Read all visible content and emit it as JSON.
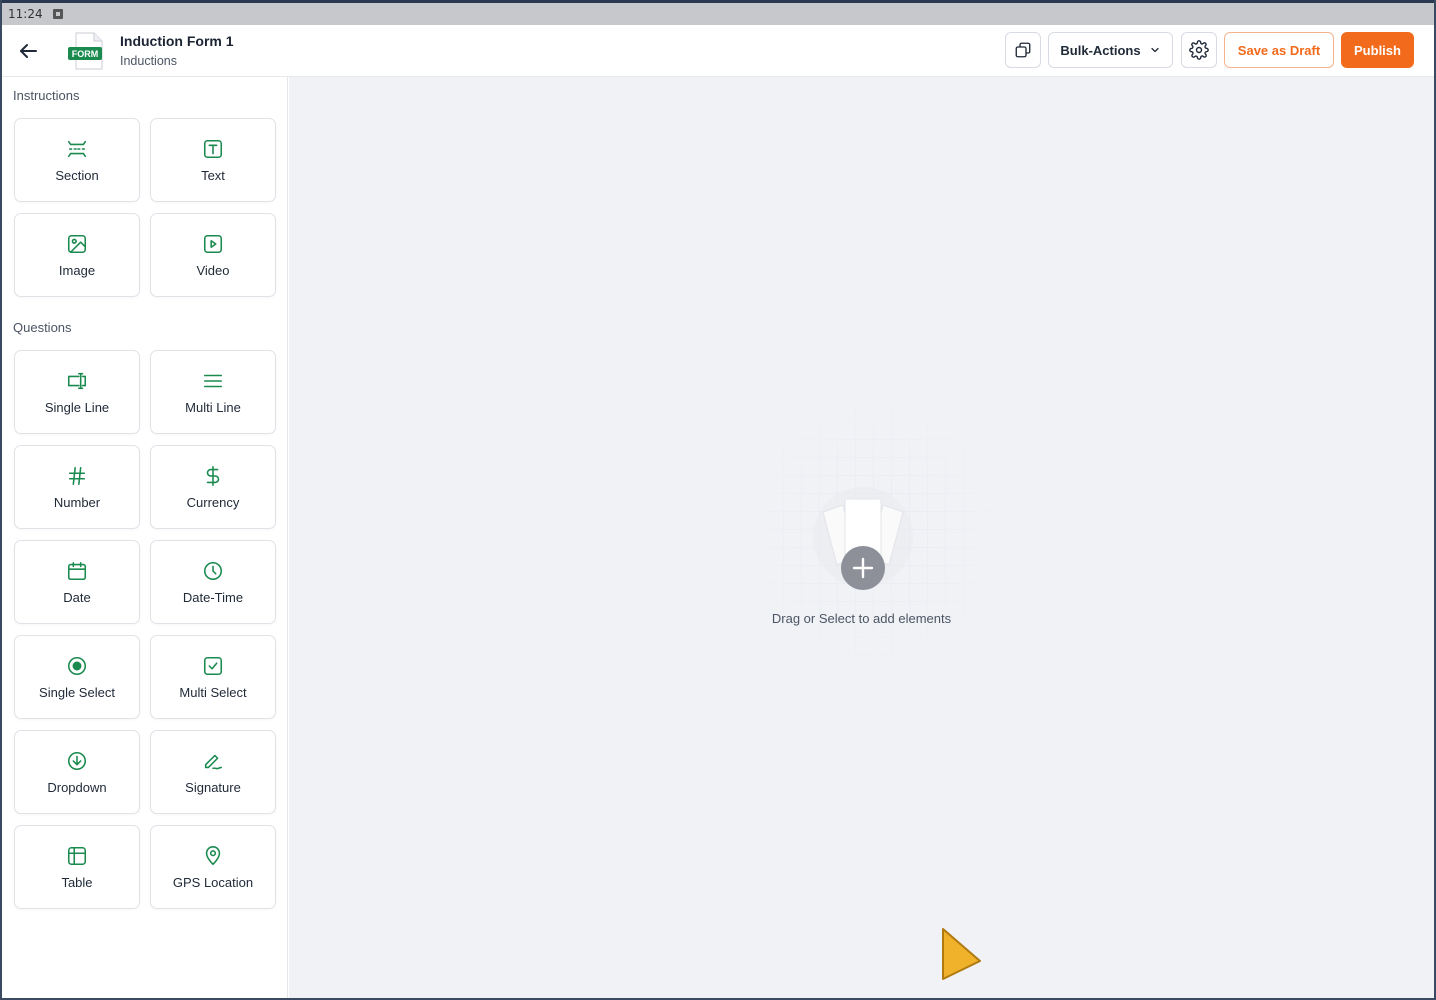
{
  "status": {
    "time": "11:24"
  },
  "header": {
    "title": "Induction Form 1",
    "subtitle": "Inductions",
    "form_badge": "FORM",
    "bulk_actions_label": "Bulk-Actions",
    "save_draft_label": "Save as Draft",
    "publish_label": "Publish"
  },
  "sidebar": {
    "instructions_label": "Instructions",
    "questions_label": "Questions",
    "instructions": [
      {
        "label": "Section",
        "icon": "section-icon"
      },
      {
        "label": "Text",
        "icon": "text-icon"
      },
      {
        "label": "Image",
        "icon": "image-icon"
      },
      {
        "label": "Video",
        "icon": "video-icon"
      }
    ],
    "questions": [
      {
        "label": "Single Line",
        "icon": "single-line-icon"
      },
      {
        "label": "Multi Line",
        "icon": "multi-line-icon"
      },
      {
        "label": "Number",
        "icon": "hash-icon"
      },
      {
        "label": "Currency",
        "icon": "dollar-icon"
      },
      {
        "label": "Date",
        "icon": "calendar-icon"
      },
      {
        "label": "Date-Time",
        "icon": "clock-icon"
      },
      {
        "label": "Single Select",
        "icon": "radio-icon"
      },
      {
        "label": "Multi Select",
        "icon": "checkbox-icon"
      },
      {
        "label": "Dropdown",
        "icon": "arrow-down-circle-icon"
      },
      {
        "label": "Signature",
        "icon": "pen-icon"
      },
      {
        "label": "Table",
        "icon": "table-icon"
      },
      {
        "label": "GPS Location",
        "icon": "map-pin-icon"
      }
    ]
  },
  "canvas": {
    "empty_text": "Drag or Select to add elements"
  },
  "colors": {
    "accent": "#f26a1b",
    "icon_green": "#1a8a4f",
    "canvas_bg": "#f1f2f6"
  }
}
